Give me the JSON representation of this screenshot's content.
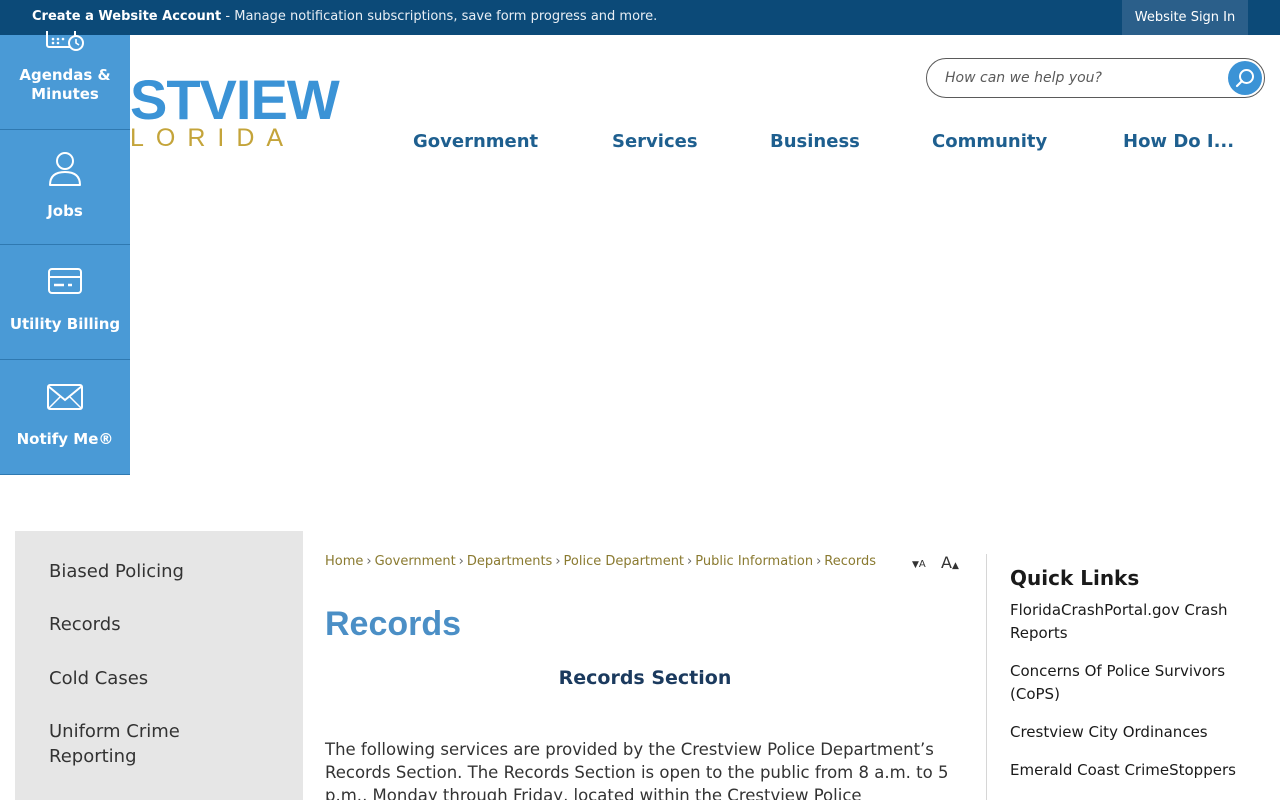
{
  "topbar": {
    "create_label": "Create a Website Account",
    "create_desc": " - Manage notification subscriptions, save form progress and more.",
    "signin_label": "Website Sign In"
  },
  "logo": {
    "word": "STVIEW",
    "sub": "LORIDA"
  },
  "search": {
    "placeholder": "How can we help you?",
    "icon": "search-icon"
  },
  "nav": [
    {
      "label": "Government"
    },
    {
      "label": "Services"
    },
    {
      "label": "Business"
    },
    {
      "label": "Community"
    },
    {
      "label": "How Do I..."
    }
  ],
  "quickbar": [
    {
      "label": "Agendas & Minutes",
      "icon": "calendar-clock-icon"
    },
    {
      "label": "Jobs",
      "icon": "person-icon"
    },
    {
      "label": "Utility Billing",
      "icon": "card-icon"
    },
    {
      "label": "Notify Me®",
      "icon": "envelope-icon"
    }
  ],
  "subnav": [
    {
      "label": "Biased Policing"
    },
    {
      "label": "Records"
    },
    {
      "label": "Cold Cases"
    },
    {
      "label": "Uniform Crime Reporting"
    }
  ],
  "breadcrumb": [
    "Home",
    "Government",
    "Departments",
    "Police Department",
    "Public Information",
    "Records"
  ],
  "resize": {
    "decrease": "A",
    "increase": "A"
  },
  "page": {
    "title": "Records",
    "section_title": "Records Section",
    "body": "The following services are provided by the Crestview Police Department’s Records Section. The Records Section is open to the public from 8 a.m. to 5 p.m., Monday through Friday, located within the Crestview Police Department"
  },
  "quick_links": {
    "title": "Quick Links",
    "items": [
      {
        "label": "FloridaCrashPortal.gov Crash Reports"
      },
      {
        "label": "Concerns Of Police Survivors (CoPS)"
      },
      {
        "label": "Crestview City Ordinances"
      },
      {
        "label": "Emerald Coast CrimeStoppers"
      }
    ]
  },
  "colors": {
    "topbar": "#0c4a78",
    "accent_blue": "#4a9ad6",
    "nav_text": "#1e5f8f",
    "gold": "#c4a43a"
  }
}
